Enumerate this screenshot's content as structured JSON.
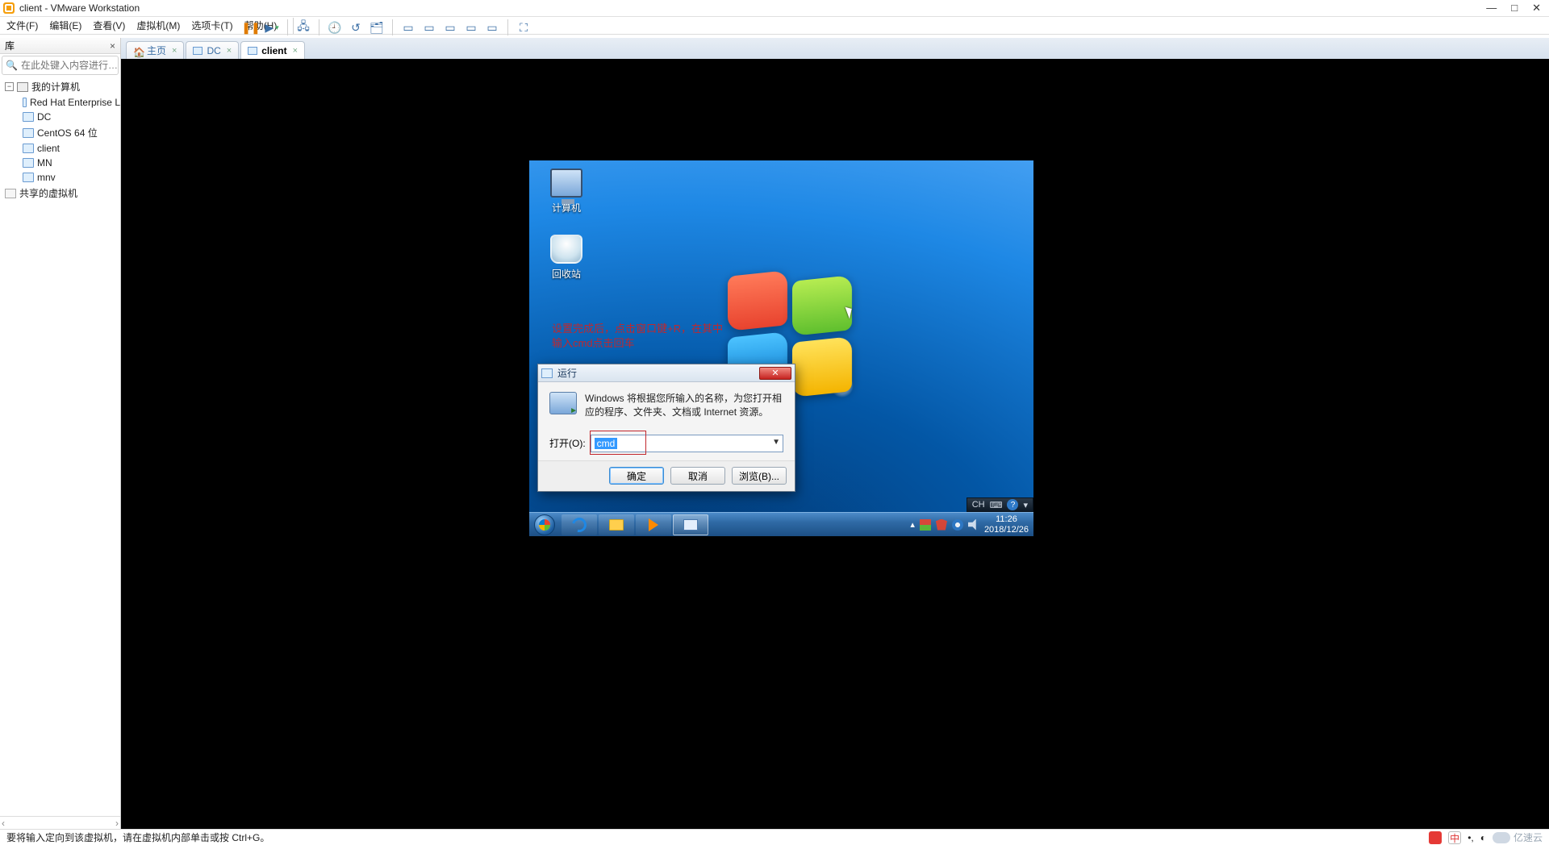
{
  "window": {
    "title": "client - VMware Workstation",
    "buttons": {
      "min": "—",
      "max": "□",
      "close": "✕"
    }
  },
  "menu": {
    "file": "文件(F)",
    "edit": "编辑(E)",
    "view": "查看(V)",
    "vm": "虚拟机(M)",
    "tabs": "选项卡(T)",
    "help": "帮助(H)"
  },
  "sidebar": {
    "title": "库",
    "search_placeholder": "在此处键入内容进行…",
    "root": "我的计算机",
    "items": [
      "Red Hat Enterprise L",
      "DC",
      "CentOS 64 位",
      "client",
      "MN",
      "mnv"
    ],
    "shared": "共享的虚拟机"
  },
  "tabs": {
    "home": "主页",
    "t1": "DC",
    "t2": "client"
  },
  "guest": {
    "icons": {
      "computer": "计算机",
      "recycle": "回收站"
    },
    "annotation": "设置完成后，点击窗口键+R，在其中输入cmd点击回车",
    "langbar": {
      "label": "CH",
      "ime": "⌨"
    },
    "time": "11:26",
    "date": "2018/12/26"
  },
  "run": {
    "title": "运行",
    "message": "Windows 将根据您所输入的名称，为您打开相应的程序、文件夹、文档或 Internet 资源。",
    "open_label": "打开(O):",
    "value": "cmd",
    "ok": "确定",
    "cancel": "取消",
    "browse": "浏览(B)..."
  },
  "status": {
    "text": "要将输入定向到该虚拟机，请在虚拟机内部单击或按 Ctrl+G。",
    "ime": "中",
    "brand": "亿速云"
  }
}
